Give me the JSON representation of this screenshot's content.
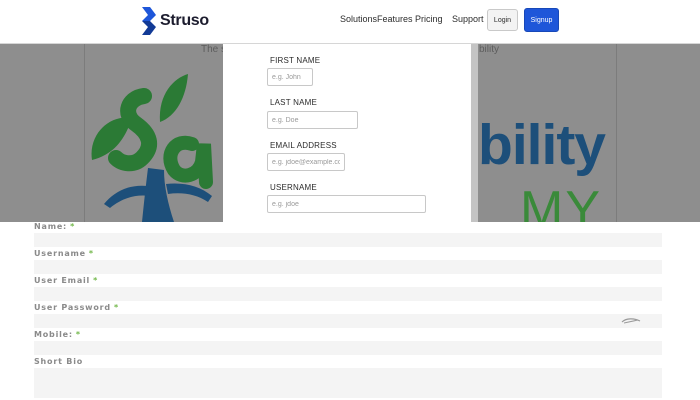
{
  "brand": {
    "name": "Struso",
    "accent": "#1e56d9"
  },
  "nav": {
    "items": [
      {
        "label": "Solutions"
      },
      {
        "label": "Features"
      },
      {
        "label": "Pricing"
      },
      {
        "label": "Support"
      }
    ],
    "login_label": "Login",
    "signup_label": "Signup"
  },
  "hero": {
    "tagline_left": "The s",
    "tagline_right": "bility",
    "word_main": "bility",
    "word_sub": "MY"
  },
  "modal": {
    "fields": [
      {
        "label": "FIRST NAME",
        "placeholder": "e.g. John"
      },
      {
        "label": "LAST NAME",
        "placeholder": "e.g. Doe"
      },
      {
        "label": "EMAIL ADDRESS",
        "placeholder": "e.g. jdoe@example.com"
      },
      {
        "label": "USERNAME",
        "placeholder": "e.g. jdoe"
      }
    ]
  },
  "profile_form": {
    "required_mark": "*",
    "fields": [
      {
        "label": "Name:"
      },
      {
        "label": "Username"
      },
      {
        "label": "User Email"
      },
      {
        "label": "User Password"
      },
      {
        "label": "Mobile:"
      },
      {
        "label": "Short Bio"
      }
    ]
  }
}
